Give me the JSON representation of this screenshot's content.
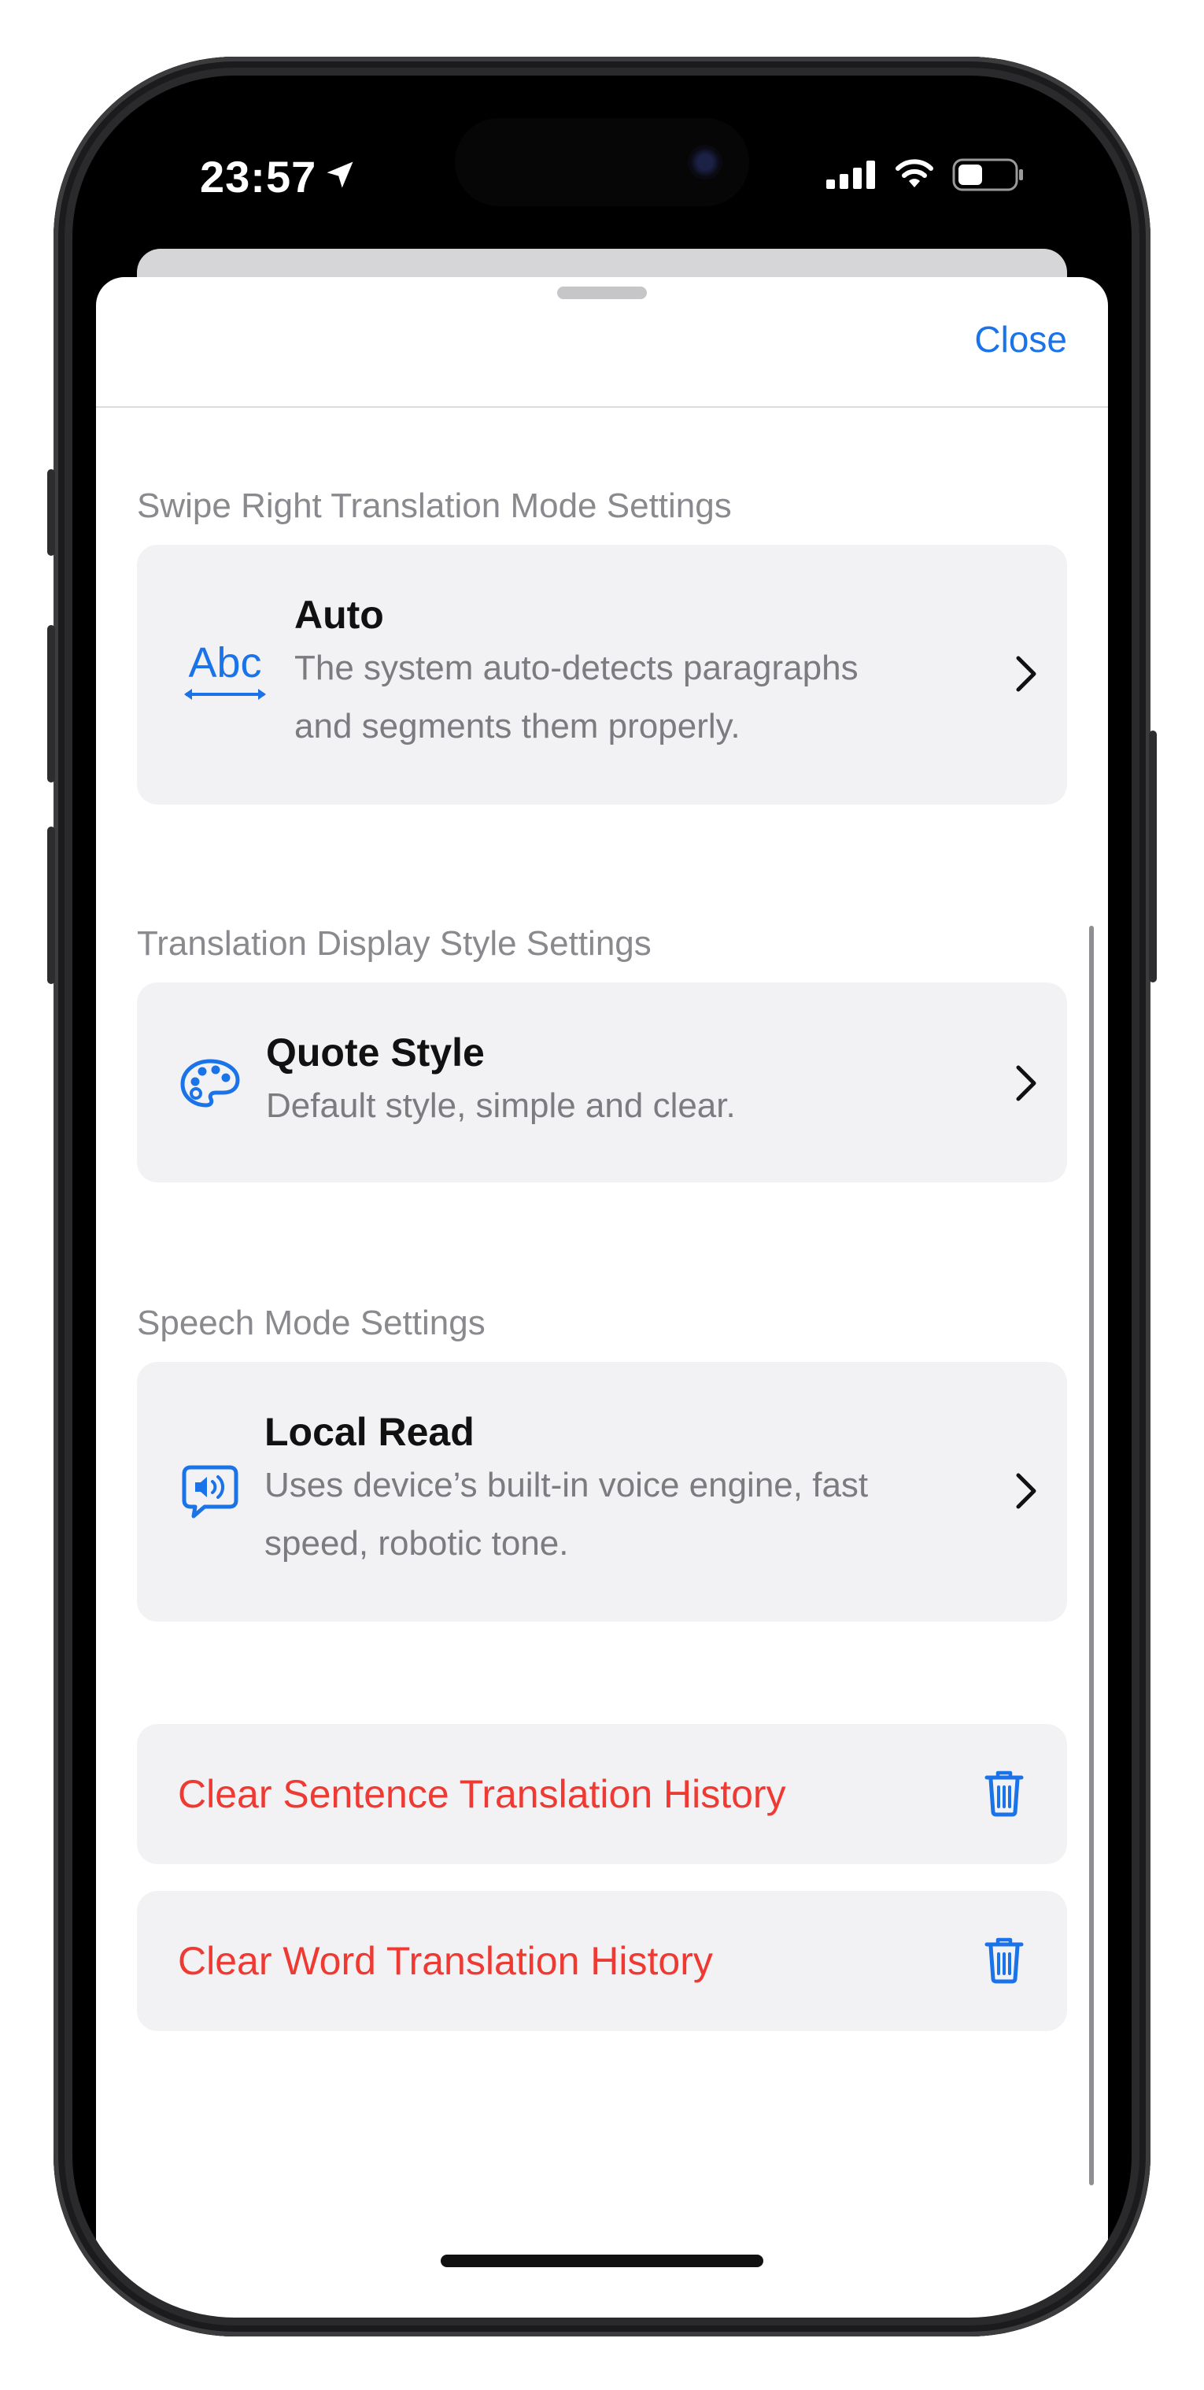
{
  "status_bar": {
    "time": "23:57",
    "location_icon": "location-arrow-icon",
    "signal_icon": "cellular-signal-icon",
    "wifi_icon": "wifi-icon",
    "battery_icon": "battery-icon"
  },
  "nav": {
    "close_label": "Close"
  },
  "sections": [
    {
      "header": "Swipe Right Translation Mode Settings",
      "icon": "abc-text-width-icon",
      "icon_text": "Abc",
      "title": "Auto",
      "description_lines": [
        "The system auto-detects paragraphs",
        "and segments them properly."
      ]
    },
    {
      "header": "Translation Display Style Settings",
      "icon": "palette-icon",
      "title": "Quote Style",
      "description_lines": [
        "Default style, simple and clear."
      ]
    },
    {
      "header": "Speech Mode Settings",
      "icon": "speaker-bubble-icon",
      "title": "Local Read",
      "description_lines": [
        "Uses device’s built-in voice engine, fast",
        "speed, robotic tone."
      ]
    }
  ],
  "actions": [
    {
      "label": "Clear Sentence Translation History",
      "icon": "trash-icon"
    },
    {
      "label": "Clear Word Translation History",
      "icon": "trash-icon"
    }
  ],
  "colors": {
    "accent_blue": "#1a73e8",
    "destructive_red": "#ee3a32",
    "card_background": "#f2f2f5",
    "secondary_text": "#8a8a8e"
  }
}
